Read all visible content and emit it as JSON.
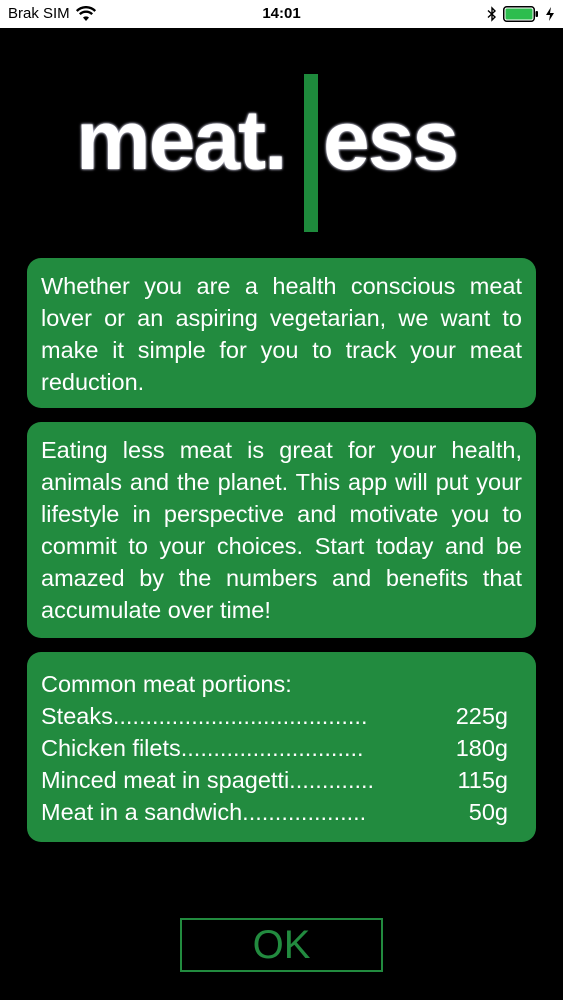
{
  "status_bar": {
    "carrier": "Brak SIM",
    "time": "14:01"
  },
  "logo": {
    "left_text": "meat.",
    "right_text": "ess"
  },
  "cards": {
    "intro": "Whether you are a health conscious meat lover or an aspiring vegetarian, we want to make it simple for you to track your meat reduction.",
    "benefits": "Eating less meat is great for your health, animals and the planet. This app will put your lifestyle in perspective and motivate you to commit to your choices. Start today and be amazed by the numbers and benefits that accumulate over time!",
    "portions": {
      "title": "Common meat portions:",
      "items": [
        {
          "name": "Steaks.......................................",
          "amount": "225g"
        },
        {
          "name": "Chicken filets............................",
          "amount": "180g"
        },
        {
          "name": "Minced meat in spagetti.............",
          "amount": "115g"
        },
        {
          "name": "Meat in a sandwich...................",
          "amount": "50g"
        }
      ]
    }
  },
  "ok_button": {
    "label": "OK"
  },
  "colors": {
    "accent": "#228b3f",
    "background": "#000000",
    "text": "#ffffff"
  }
}
